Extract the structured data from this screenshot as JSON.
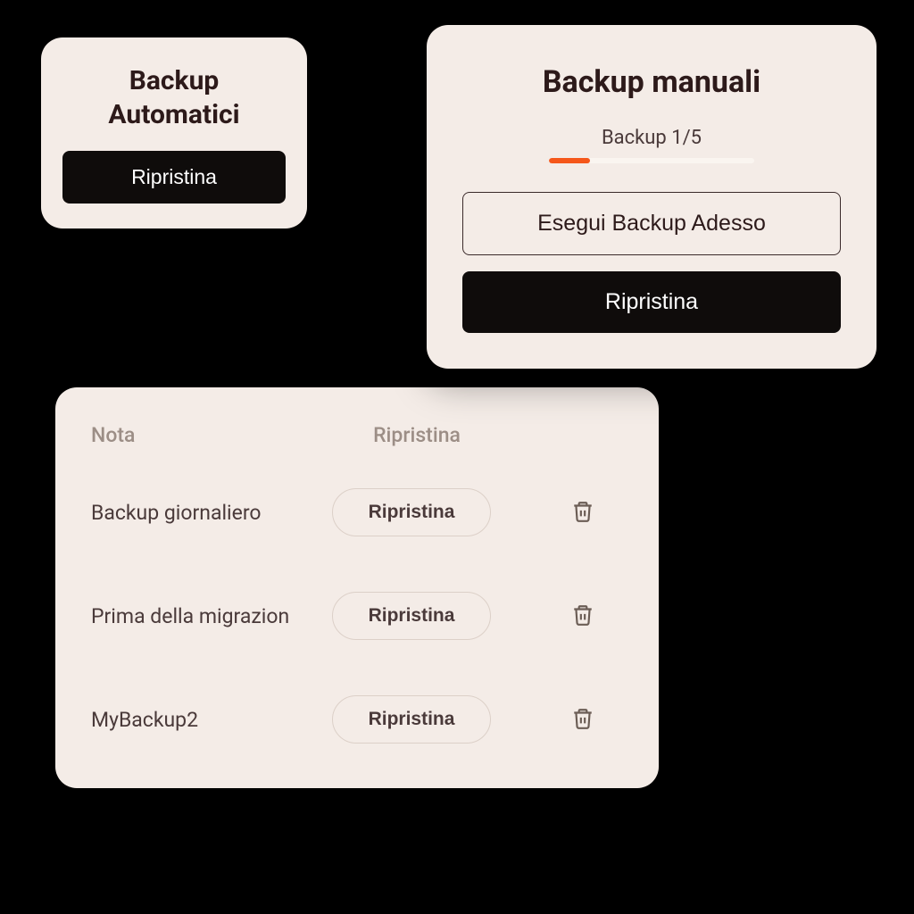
{
  "auto": {
    "title_line1": "Backup",
    "title_line2": "Automatici",
    "restore_label": "Ripristina"
  },
  "manual": {
    "title": "Backup manuali",
    "count_label": "Backup 1/5",
    "progress_percent": 20,
    "run_label": "Esegui Backup Adesso",
    "restore_label": "Ripristina"
  },
  "list": {
    "headers": {
      "note": "Nota",
      "restore": "Ripristina"
    },
    "restore_label": "Ripristina",
    "rows": [
      {
        "label": "Backup giornaliero"
      },
      {
        "label": "Prima della migrazion"
      },
      {
        "label": "MyBackup2"
      }
    ]
  }
}
